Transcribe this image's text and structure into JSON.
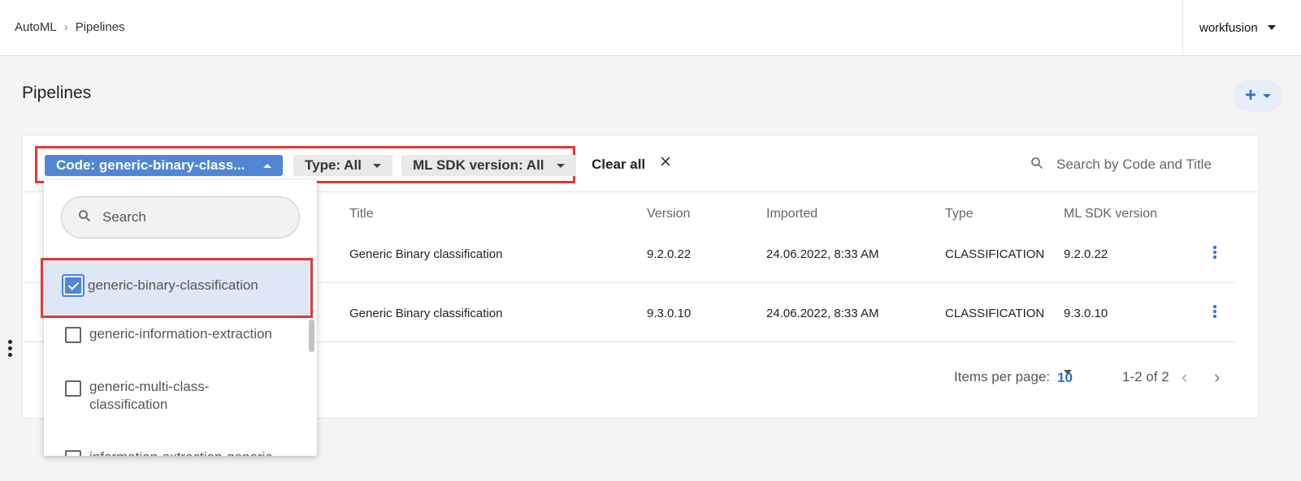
{
  "breadcrumb": {
    "root": "AutoML",
    "current": "Pipelines"
  },
  "account": {
    "name": "workfusion"
  },
  "page": {
    "title": "Pipelines"
  },
  "filters": {
    "code_label": "Code: generic-binary-class...",
    "type_label": "Type: All",
    "sdk_label": "ML SDK version: All",
    "clear_all": "Clear all",
    "search_placeholder": "Search by Code and Title"
  },
  "dropdown": {
    "search_placeholder": "Search",
    "options": [
      {
        "label": "generic-binary-classification",
        "checked": true
      },
      {
        "label": "generic-information-extraction",
        "checked": false
      },
      {
        "label": "generic-multi-class-classification",
        "checked": false
      },
      {
        "label": "information-extraction-generic",
        "checked": false
      }
    ]
  },
  "table": {
    "columns": [
      "Title",
      "Version",
      "Imported",
      "Type",
      "ML SDK version"
    ],
    "rows": [
      {
        "title": "Generic Binary classification",
        "version": "9.2.0.22",
        "imported": "24.06.2022, 8:33 AM",
        "type": "CLASSIFICATION",
        "sdk": "9.2.0.22"
      },
      {
        "title": "Generic Binary classification",
        "version": "9.3.0.10",
        "imported": "24.06.2022, 8:33 AM",
        "type": "CLASSIFICATION",
        "sdk": "9.3.0.10"
      }
    ]
  },
  "pagination": {
    "items_per_page_label": "Items per page:",
    "items_per_page_value": "10",
    "range": "1-2 of 2"
  },
  "colors": {
    "accent": "#4f86d6",
    "highlight": "#e53935",
    "link": "#2a6fd6"
  }
}
